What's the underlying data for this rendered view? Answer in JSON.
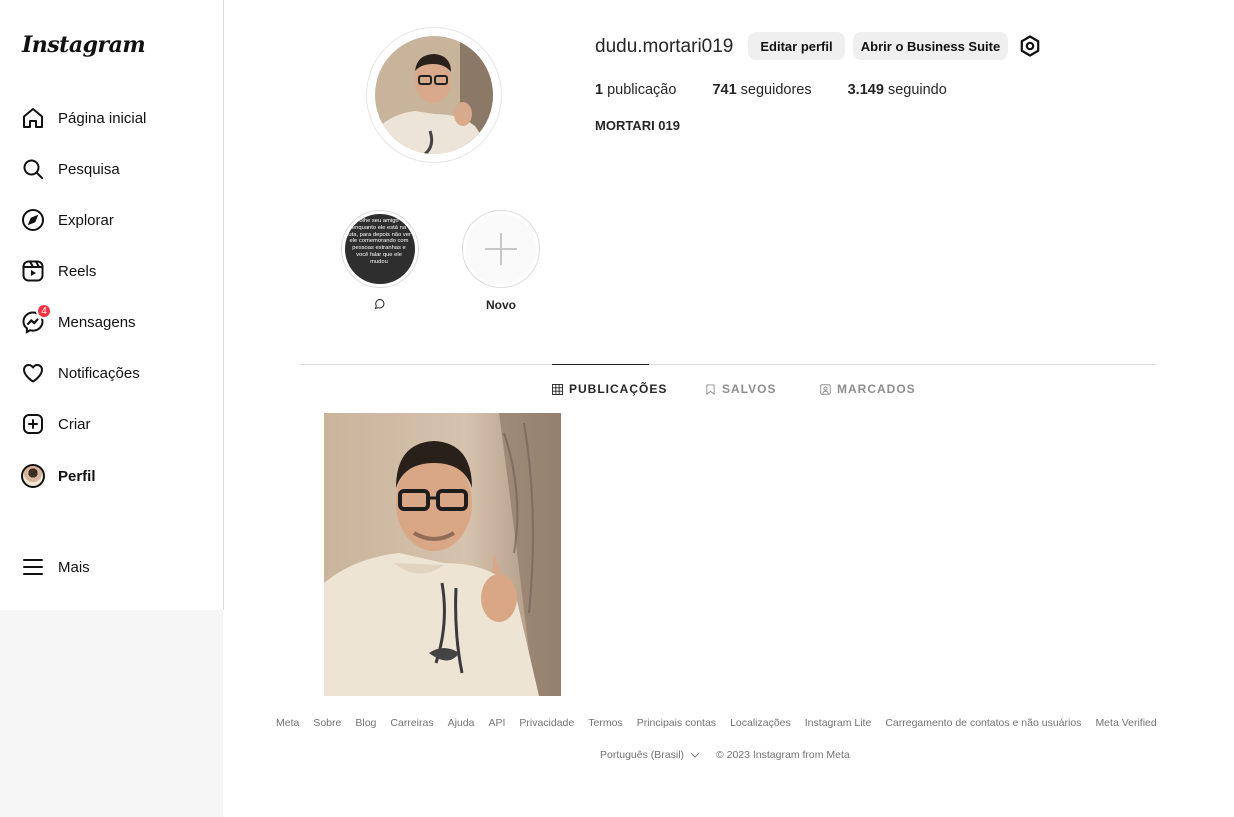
{
  "app": {
    "logo_text": "Instagram"
  },
  "sidebar": {
    "items": [
      {
        "label": "Página inicial",
        "icon": "home-icon"
      },
      {
        "label": "Pesquisa",
        "icon": "search-icon"
      },
      {
        "label": "Explorar",
        "icon": "compass-icon"
      },
      {
        "label": "Reels",
        "icon": "reels-icon"
      },
      {
        "label": "Mensagens",
        "icon": "messenger-icon",
        "badge": "4"
      },
      {
        "label": "Notificações",
        "icon": "heart-icon"
      },
      {
        "label": "Criar",
        "icon": "plus-square-icon"
      },
      {
        "label": "Perfil",
        "icon": "avatar"
      },
      {
        "label": "Mais",
        "icon": "menu-icon"
      }
    ]
  },
  "profile": {
    "username": "dudu.mortari019",
    "edit_button": "Editar perfil",
    "business_button": "Abrir o Business Suite",
    "stats": {
      "posts_count": "1",
      "posts_label": "publicação",
      "followers_count": "741",
      "followers_label": "seguidores",
      "following_count": "3.149",
      "following_label": "seguindo"
    },
    "full_name": "MORTARI 019"
  },
  "highlights": [
    {
      "caption": "",
      "caption_icon": "comment-bubble-icon",
      "text": "olhe seu amigo enquanto ele está na luta, para depois não ver ele comemorando com pessoas estranhas e você falar que ele mudou"
    },
    {
      "caption": "Novo",
      "icon": "plus-icon"
    }
  ],
  "tabs": [
    {
      "label": "PUBLICAÇÕES",
      "icon": "grid-icon",
      "active": true
    },
    {
      "label": "SALVOS",
      "icon": "bookmark-icon",
      "active": false
    },
    {
      "label": "MARCADOS",
      "icon": "tagged-icon",
      "active": false
    }
  ],
  "footer": {
    "links": [
      "Meta",
      "Sobre",
      "Blog",
      "Carreiras",
      "Ajuda",
      "API",
      "Privacidade",
      "Termos",
      "Principais contas",
      "Localizações",
      "Instagram Lite",
      "Carregamento de contatos e não usuários",
      "Meta Verified"
    ],
    "language": "Português (Brasil)",
    "copyright": "© 2023 Instagram from Meta"
  },
  "colors": {
    "badge": "#ff3040",
    "button_bg": "#efefef",
    "muted_text": "#737373",
    "divider": "#dbdbdb"
  }
}
